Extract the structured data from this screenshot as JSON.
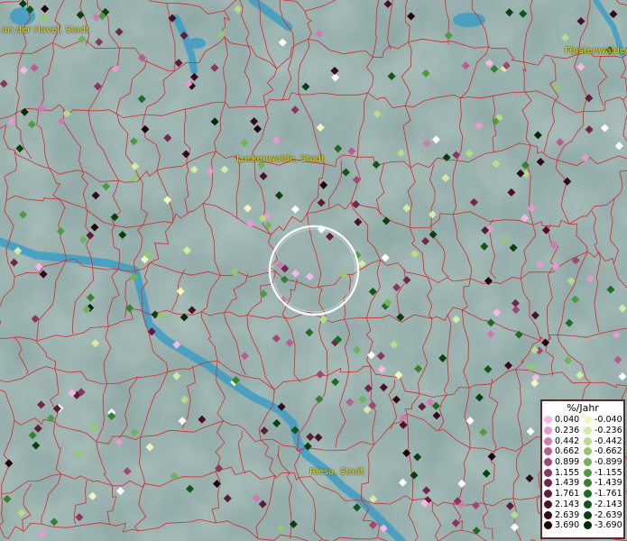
{
  "map": {
    "labels": [
      {
        "name": "label-brandenburg",
        "text": "an der Havel, Stadt"
      },
      {
        "name": "label-fuerstenwalde",
        "text": "Fürstenwalde/"
      },
      {
        "name": "label-luckenwalde",
        "text": "Luckenwalde, Stadt"
      },
      {
        "name": "label-riesa",
        "text": "Riesa, Stadt"
      }
    ],
    "colors": {
      "background": "#8fa9a6",
      "water": "#3d9cc4",
      "borders": "#d42a2a",
      "label": "#e8e000",
      "selection_ring": "#ffffff"
    }
  },
  "legend": {
    "title": "%/Jahr",
    "positive": [
      {
        "value": "0.040",
        "color": "#f5b8e6"
      },
      {
        "value": "0.236",
        "color": "#e59ad0"
      },
      {
        "value": "0.442",
        "color": "#d07ab4"
      },
      {
        "value": "0.662",
        "color": "#b85b92"
      },
      {
        "value": "0.899",
        "color": "#a14776"
      },
      {
        "value": "1.155",
        "color": "#8a3660"
      },
      {
        "value": "1.439",
        "color": "#72264b"
      },
      {
        "value": "1.761",
        "color": "#5e1b3a"
      },
      {
        "value": "2.143",
        "color": "#4a1029"
      },
      {
        "value": "2.639",
        "color": "#36081c"
      },
      {
        "value": "3.690",
        "color": "#1f020d"
      }
    ],
    "negative": [
      {
        "value": "-0.040",
        "color": "#f1f7be"
      },
      {
        "value": "-0.236",
        "color": "#d4eaa6"
      },
      {
        "value": "-0.442",
        "color": "#b6dc8c"
      },
      {
        "value": "-0.662",
        "color": "#92c872"
      },
      {
        "value": "-0.899",
        "color": "#6fb25a"
      },
      {
        "value": "-1.155",
        "color": "#4e9a44"
      },
      {
        "value": "-1.439",
        "color": "#34822f"
      },
      {
        "value": "-1.761",
        "color": "#206a22"
      },
      {
        "value": "-2.143",
        "color": "#125518"
      },
      {
        "value": "-2.639",
        "color": "#0a4010"
      },
      {
        "value": "-3.690",
        "color": "#042a08"
      }
    ]
  }
}
